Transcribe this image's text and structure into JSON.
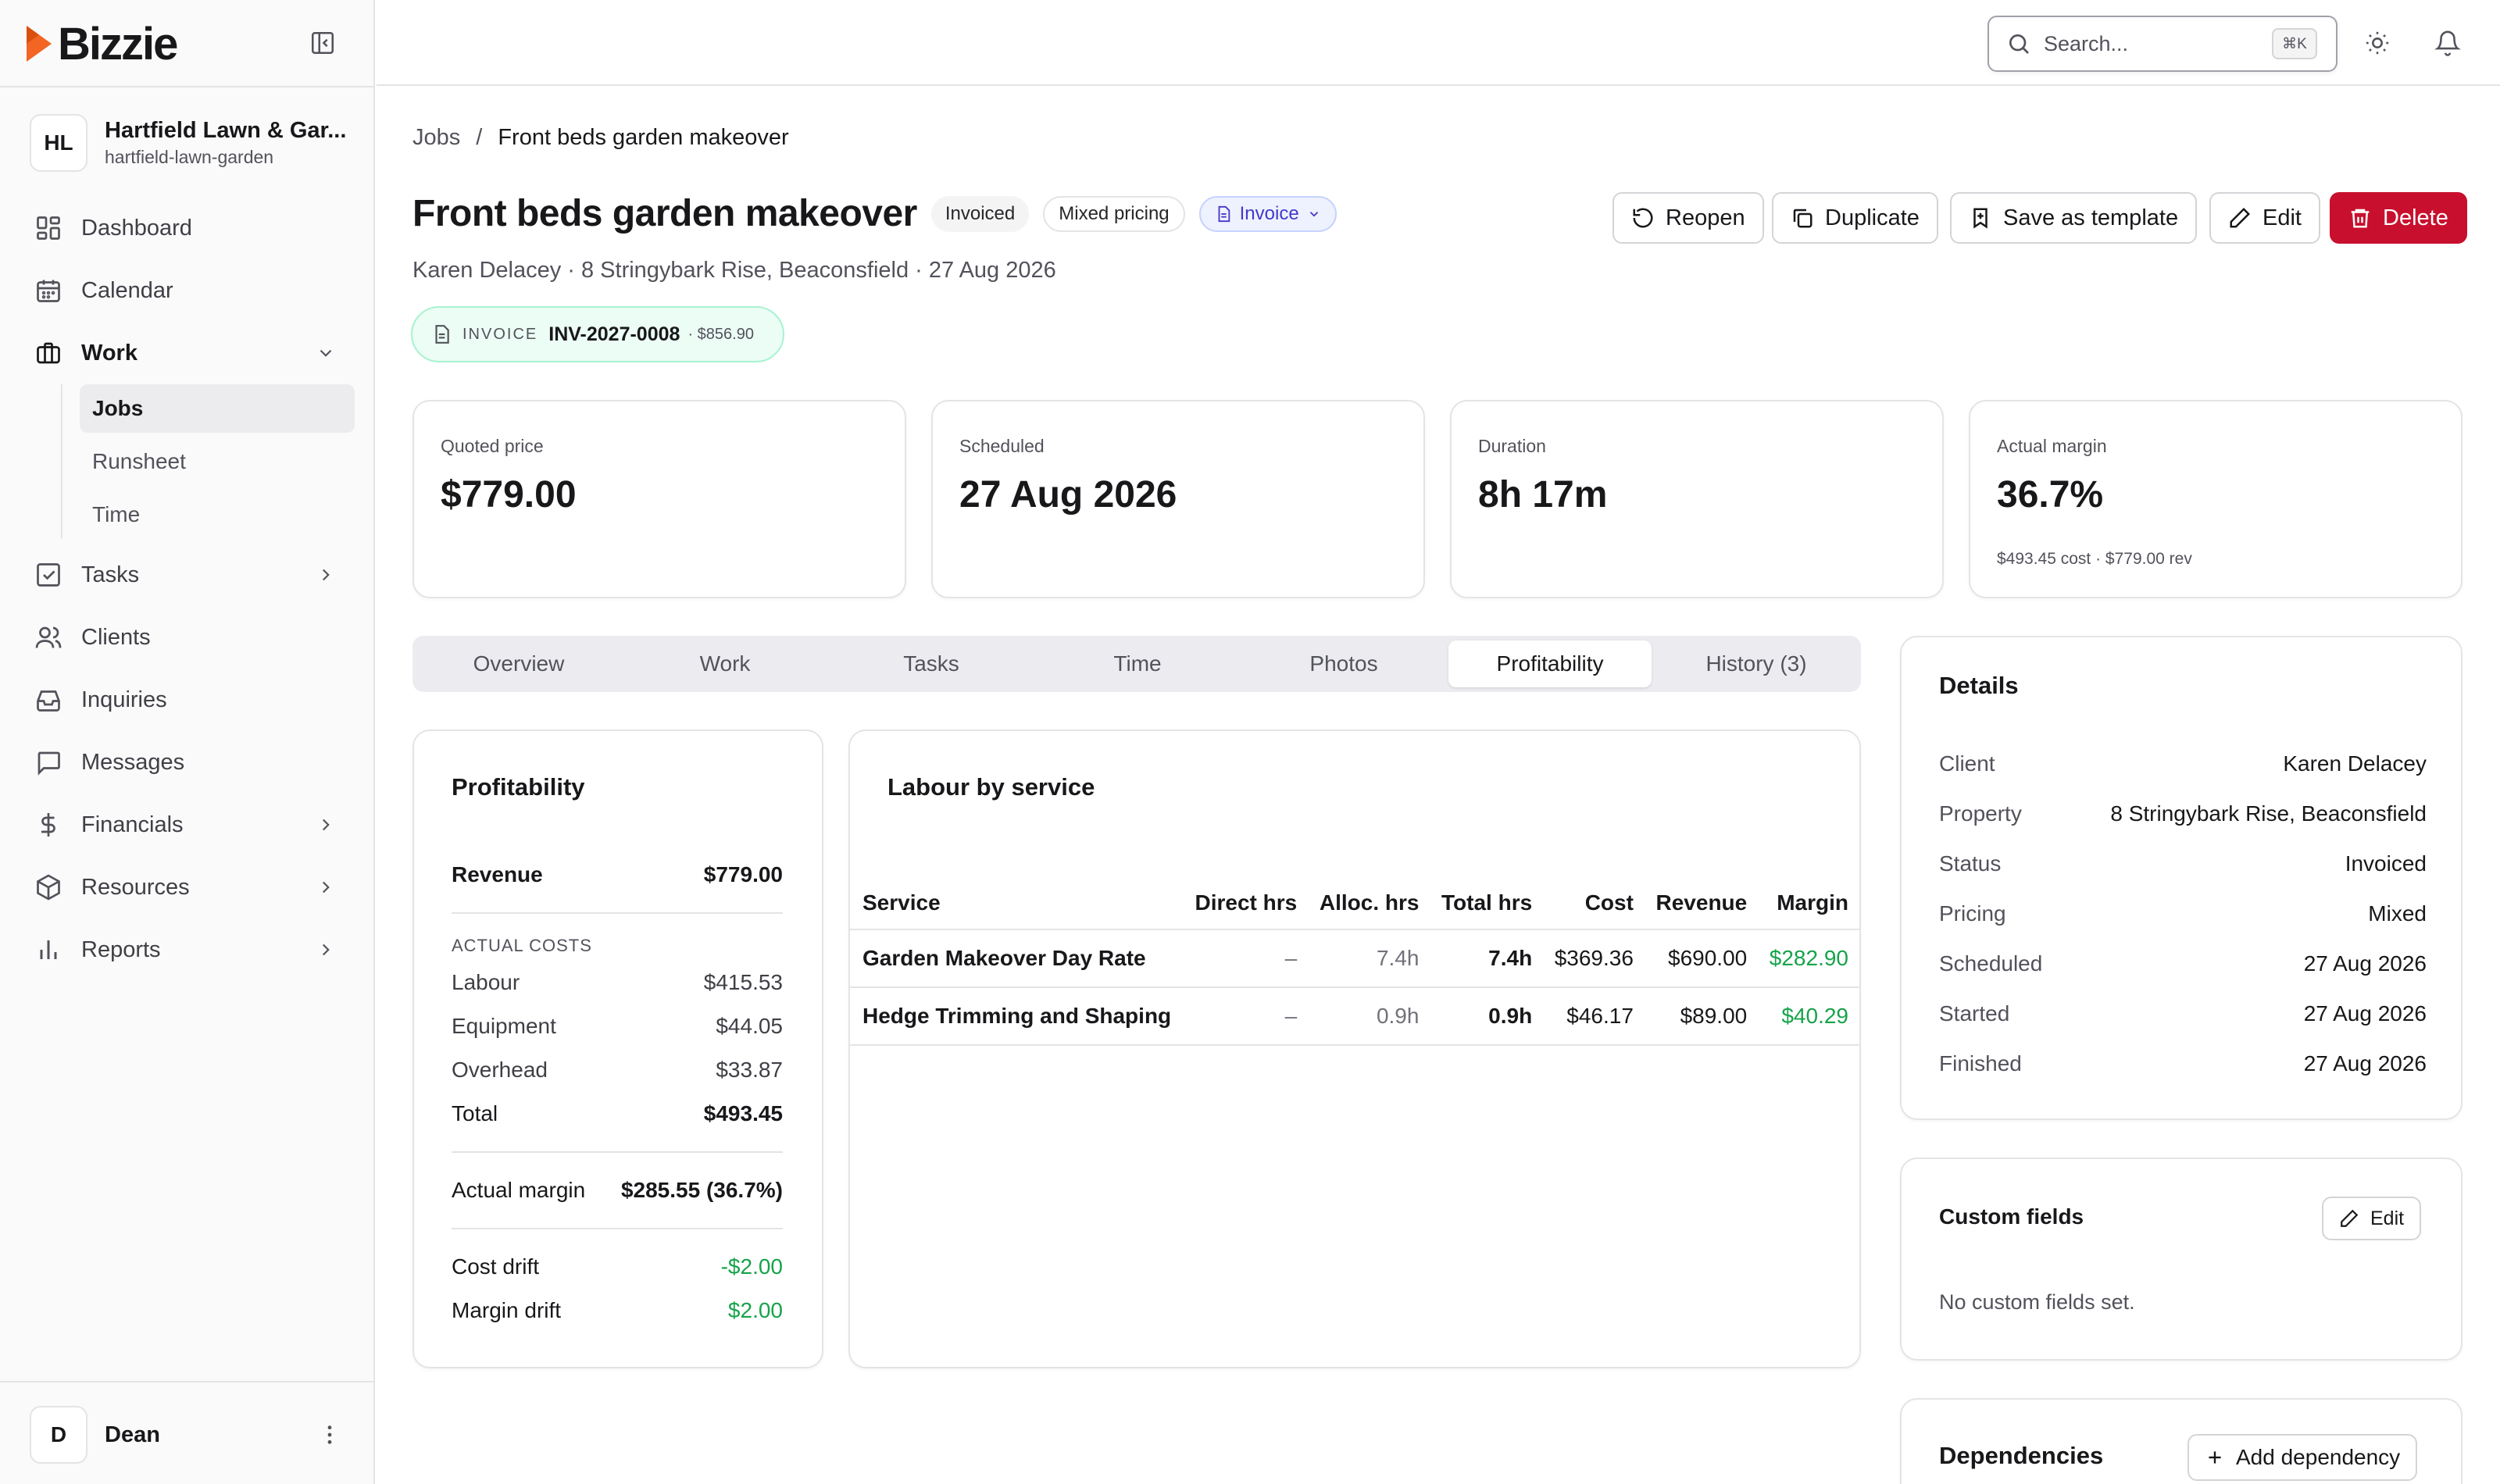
{
  "brand": {
    "name": "Bizzie",
    "accent": "#f26522"
  },
  "org": {
    "initials": "HL",
    "name": "Hartfield Lawn & Gar...",
    "slug": "hartfield-lawn-garden"
  },
  "nav": {
    "dashboard": "Dashboard",
    "calendar": "Calendar",
    "work": "Work",
    "work_sub": {
      "jobs": "Jobs",
      "runsheet": "Runsheet",
      "time": "Time"
    },
    "tasks": "Tasks",
    "clients": "Clients",
    "inquiries": "Inquiries",
    "messages": "Messages",
    "financials": "Financials",
    "resources": "Resources",
    "reports": "Reports"
  },
  "user": {
    "initial": "D",
    "name": "Dean"
  },
  "search": {
    "placeholder": "Search...",
    "shortcut": "⌘K"
  },
  "breadcrumb": {
    "parent": "Jobs",
    "sep": "/",
    "current": "Front beds garden makeover"
  },
  "job": {
    "title": "Front beds garden makeover",
    "status_badge": "Invoiced",
    "pricing_badge": "Mixed pricing",
    "invoice_badge": "Invoice",
    "subtitle": "Karen Delacey · 8 Stringybark Rise, Beaconsfield · 27 Aug 2026",
    "invoice_chip": {
      "label": "INVOICE",
      "number": "INV-2027-0008",
      "amount": "· $856.90"
    }
  },
  "actions": {
    "reopen": "Reopen",
    "duplicate": "Duplicate",
    "save_template": "Save as template",
    "edit": "Edit",
    "delete": "Delete"
  },
  "stats": [
    {
      "label": "Quoted price",
      "value": "$779.00",
      "sub": ""
    },
    {
      "label": "Scheduled",
      "value": "27 Aug 2026",
      "sub": ""
    },
    {
      "label": "Duration",
      "value": "8h 17m",
      "sub": ""
    },
    {
      "label": "Actual margin",
      "value": "36.7%",
      "sub": "$493.45 cost · $779.00 rev"
    }
  ],
  "tabs": [
    "Overview",
    "Work",
    "Tasks",
    "Time",
    "Photos",
    "Profitability",
    "History (3)"
  ],
  "active_tab": "Profitability",
  "profitability": {
    "title": "Profitability",
    "revenue_label": "Revenue",
    "revenue": "$779.00",
    "costs_heading": "ACTUAL COSTS",
    "labour_label": "Labour",
    "labour": "$415.53",
    "equipment_label": "Equipment",
    "equipment": "$44.05",
    "overhead_label": "Overhead",
    "overhead": "$33.87",
    "total_label": "Total",
    "total": "$493.45",
    "margin_label": "Actual margin",
    "margin": "$285.55 (36.7%)",
    "cost_drift_label": "Cost drift",
    "cost_drift": "-$2.00",
    "margin_drift_label": "Margin drift",
    "margin_drift": "$2.00"
  },
  "labour": {
    "title": "Labour by service",
    "columns": {
      "service": "Service",
      "direct": "Direct hrs",
      "alloc": "Alloc. hrs",
      "total": "Total hrs",
      "cost": "Cost",
      "revenue": "Revenue",
      "margin": "Margin"
    },
    "rows": [
      {
        "service": "Garden Makeover Day Rate",
        "direct": "–",
        "alloc": "7.4h",
        "total": "7.4h",
        "cost": "$369.36",
        "revenue": "$690.00",
        "margin": "$282.90"
      },
      {
        "service": "Hedge Trimming and Shaping",
        "direct": "–",
        "alloc": "0.9h",
        "total": "0.9h",
        "cost": "$46.17",
        "revenue": "$89.00",
        "margin": "$40.29"
      }
    ]
  },
  "details": {
    "title": "Details",
    "client_label": "Client",
    "client": "Karen Delacey",
    "property_label": "Property",
    "property": "8 Stringybark Rise, Beaconsfield",
    "status_label": "Status",
    "status": "Invoiced",
    "pricing_label": "Pricing",
    "pricing": "Mixed",
    "scheduled_label": "Scheduled",
    "scheduled": "27 Aug 2026",
    "started_label": "Started",
    "started": "27 Aug 2026",
    "finished_label": "Finished",
    "finished": "27 Aug 2026"
  },
  "custom_fields": {
    "title": "Custom fields",
    "edit": "Edit",
    "empty": "No custom fields set."
  },
  "dependencies": {
    "title": "Dependencies",
    "add": "Add dependency"
  }
}
